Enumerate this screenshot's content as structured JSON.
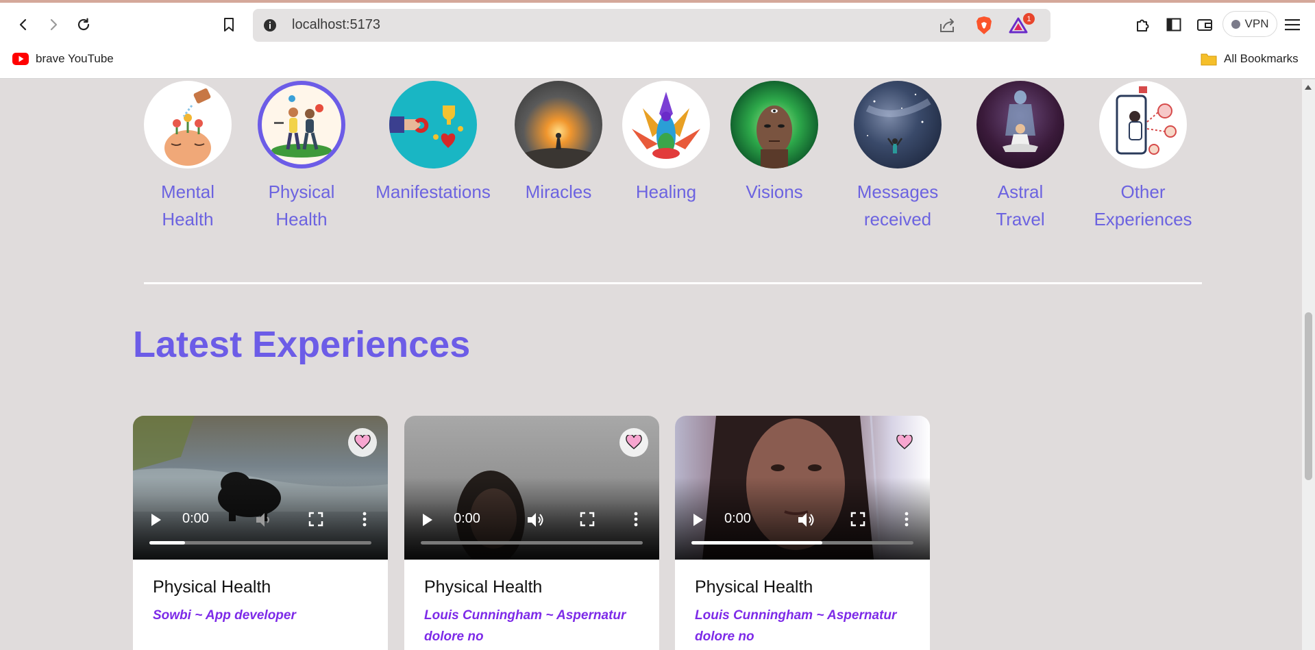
{
  "browser": {
    "url": "localhost:5173",
    "bookmarks": [
      {
        "label": "brave YouTube",
        "icon": "youtube-icon"
      }
    ],
    "all_bookmarks_label": "All Bookmarks",
    "vpn_label": "VPN",
    "notification_count": "1"
  },
  "categories": [
    {
      "label_line1": "Mental",
      "label_line2": "Health",
      "icon": "mental-health-image",
      "selected": false
    },
    {
      "label_line1": "Physical",
      "label_line2": "Health",
      "icon": "physical-health-image",
      "selected": true
    },
    {
      "label_line1": "Manifestations",
      "label_line2": "",
      "icon": "manifestations-image",
      "selected": false
    },
    {
      "label_line1": "Miracles",
      "label_line2": "",
      "icon": "miracles-image",
      "selected": false
    },
    {
      "label_line1": "Healing",
      "label_line2": "",
      "icon": "healing-image",
      "selected": false
    },
    {
      "label_line1": "Visions",
      "label_line2": "",
      "icon": "visions-image",
      "selected": false
    },
    {
      "label_line1": "Messages",
      "label_line2": "received",
      "icon": "messages-image",
      "selected": false
    },
    {
      "label_line1": "Astral",
      "label_line2": "Travel",
      "icon": "astral-travel-image",
      "selected": false
    },
    {
      "label_line1": "Other",
      "label_line2": "Experiences",
      "icon": "other-experiences-image",
      "selected": false
    }
  ],
  "section_title": "Latest Experiences",
  "accent_color": "#6c5ce7",
  "cards": [
    {
      "title": "Physical Health",
      "author": "Sowbi ~ App developer",
      "time": "0:00",
      "progress": 0.16,
      "muted": true
    },
    {
      "title": "Physical Health",
      "author": "Louis Cunningham ~ Aspernatur dolore no",
      "time": "0:00",
      "progress": 0.0,
      "muted": false
    },
    {
      "title": "Physical Health",
      "author": "Louis Cunningham ~ Aspernatur dolore no",
      "time": "0:00",
      "progress": 0.59,
      "muted": false
    }
  ]
}
